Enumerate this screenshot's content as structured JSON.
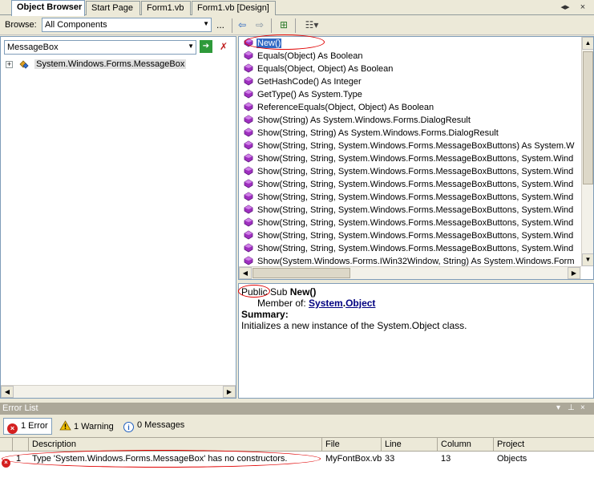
{
  "tabs": [
    {
      "label": "Object Browser",
      "active": true
    },
    {
      "label": "Start Page",
      "active": false
    },
    {
      "label": "Form1.vb",
      "active": false
    },
    {
      "label": "Form1.vb [Design]",
      "active": false
    }
  ],
  "tab_controls": {
    "nav": "◂▸",
    "close": "×"
  },
  "browse": {
    "label": "Browse:",
    "value": "All Components",
    "more": "..."
  },
  "toolbar": {
    "back": "⇦",
    "forward": "⇨",
    "add_reference": "⊞",
    "settings": "☷▾"
  },
  "search": {
    "value": "MessageBox",
    "go_icon": "➔",
    "clear_icon": "✗"
  },
  "tree": {
    "node_label": "System.Windows.Forms.MessageBox",
    "expander": "+"
  },
  "members": [
    {
      "label": "New()",
      "selected": true
    },
    {
      "label": "Equals(Object) As Boolean"
    },
    {
      "label": "Equals(Object, Object) As Boolean"
    },
    {
      "label": "GetHashCode() As Integer"
    },
    {
      "label": "GetType() As System.Type"
    },
    {
      "label": "ReferenceEquals(Object, Object) As Boolean"
    },
    {
      "label": "Show(String) As System.Windows.Forms.DialogResult"
    },
    {
      "label": "Show(String, String) As System.Windows.Forms.DialogResult"
    },
    {
      "label": "Show(String, String, System.Windows.Forms.MessageBoxButtons) As System.W"
    },
    {
      "label": "Show(String, String, System.Windows.Forms.MessageBoxButtons, System.Wind"
    },
    {
      "label": "Show(String, String, System.Windows.Forms.MessageBoxButtons, System.Wind"
    },
    {
      "label": "Show(String, String, System.Windows.Forms.MessageBoxButtons, System.Wind"
    },
    {
      "label": "Show(String, String, System.Windows.Forms.MessageBoxButtons, System.Wind"
    },
    {
      "label": "Show(String, String, System.Windows.Forms.MessageBoxButtons, System.Wind"
    },
    {
      "label": "Show(String, String, System.Windows.Forms.MessageBoxButtons, System.Wind"
    },
    {
      "label": "Show(String, String, System.Windows.Forms.MessageBoxButtons, System.Wind"
    },
    {
      "label": "Show(String, String, System.Windows.Forms.MessageBoxButtons, System.Wind"
    },
    {
      "label": "Show(System.Windows.Forms.IWin32Window, String) As System.Windows.Form"
    }
  ],
  "description": {
    "modifier": "Public",
    "keyword": "Sub",
    "name": "New()",
    "member_of_label": "Member of:",
    "member_of_ns": "System",
    "member_of_dot": ".",
    "member_of_class": "Object",
    "summary_label": "Summary:",
    "summary_text": "Initializes a new instance of the System.Object class."
  },
  "error_list": {
    "title": "Error List",
    "title_controls": {
      "dropdown": "▾",
      "pin": "⊥",
      "close": "×"
    },
    "buttons": [
      {
        "label": "1 Error",
        "icon": "error-icon",
        "pressed": true
      },
      {
        "label": "1 Warning",
        "icon": "warning-icon",
        "pressed": false
      },
      {
        "label": "0 Messages",
        "icon": "info-icon",
        "pressed": false
      }
    ],
    "columns": [
      "Description",
      "File",
      "Line",
      "Column",
      "Project"
    ],
    "rows": [
      {
        "index": "1",
        "description": "Type 'System.Windows.Forms.MessageBox' has no constructors.",
        "file": "MyFontBox.vb",
        "line": "33",
        "column": "13",
        "project": "Objects"
      }
    ]
  },
  "colors": {
    "selection": "#316ac5",
    "error": "#d42020",
    "warning": "#f0c000",
    "info": "#2060c0",
    "method_icon": "#a030c0",
    "annotation": "#e00000"
  }
}
